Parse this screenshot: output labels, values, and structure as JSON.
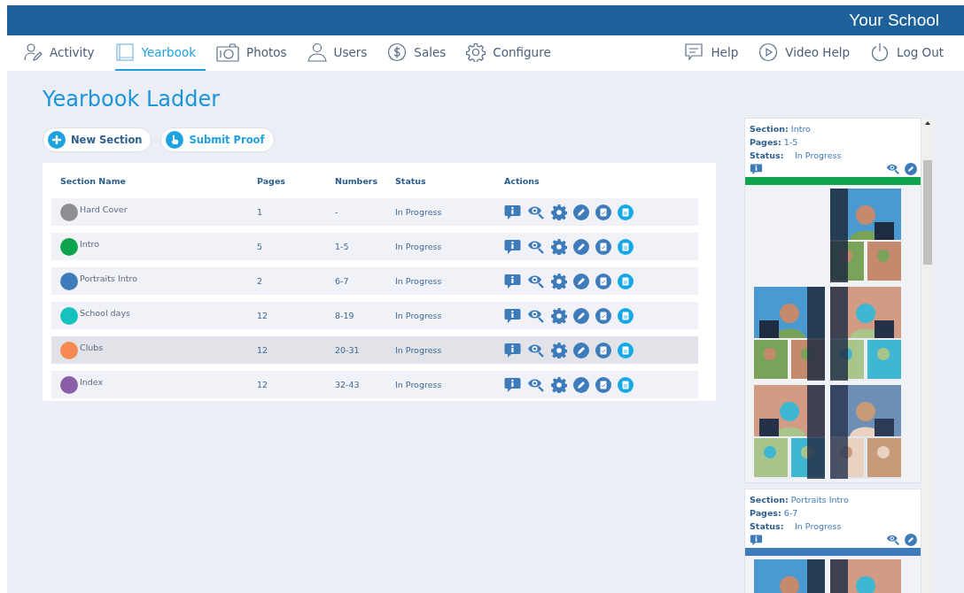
{
  "header": {
    "school": "Your School"
  },
  "nav": {
    "left": [
      {
        "label": "Activity",
        "selected": false
      },
      {
        "label": "Yearbook",
        "selected": true
      },
      {
        "label": "Photos",
        "selected": false
      },
      {
        "label": "Users",
        "selected": false
      },
      {
        "label": "Sales",
        "selected": false
      },
      {
        "label": "Configure",
        "selected": false
      }
    ],
    "right": [
      {
        "label": "Help"
      },
      {
        "label": "Video Help"
      },
      {
        "label": "Log Out"
      }
    ]
  },
  "title": "Yearbook Ladder",
  "buttons": [
    "New Section",
    "Submit Proof"
  ],
  "table": {
    "columns": [
      "Section Name",
      "Pages",
      "Numbers",
      "Status",
      "Actions"
    ],
    "rows": [
      {
        "name": "Hard Cover",
        "color": "#8e8f93",
        "pages": "1",
        "numbers": "-",
        "status": "In Progress",
        "selected": false
      },
      {
        "name": "Intro",
        "color": "#0ea44c",
        "pages": "5",
        "numbers": "1-5",
        "status": "In Progress",
        "selected": false
      },
      {
        "name": "Portraits Intro",
        "color": "#3d7bbb",
        "pages": "2",
        "numbers": "6-7",
        "status": "In Progress",
        "selected": false
      },
      {
        "name": "School days",
        "color": "#16c2be",
        "pages": "12",
        "numbers": "8-19",
        "status": "In Progress",
        "selected": false
      },
      {
        "name": "Clubs",
        "color": "#f68a52",
        "pages": "12",
        "numbers": "20-31",
        "status": "In Progress",
        "selected": true
      },
      {
        "name": "Index",
        "color": "#8a5fa8",
        "pages": "12",
        "numbers": "32-43",
        "status": "In Progress",
        "selected": false
      }
    ]
  },
  "previews": [
    {
      "section_label": "Section:",
      "section": "Intro",
      "pages_label": "Pages:",
      "pages": "1-5",
      "status_label": "Status:",
      "status": "In Progress",
      "color": "#0ea44c",
      "spreads": [
        [
          {
            "kind": "blank"
          },
          {
            "kind": "picture"
          }
        ],
        [
          {
            "kind": "picture"
          },
          {
            "kind": "picture"
          }
        ],
        [
          {
            "kind": "picture"
          },
          {
            "kind": "picture"
          }
        ]
      ]
    },
    {
      "section_label": "Section:",
      "section": "Portraits Intro",
      "pages_label": "Pages:",
      "pages": "6-7",
      "status_label": "Status:",
      "status": "In Progress",
      "color": "#3d7bbb",
      "spreads": [
        [
          {
            "kind": "picture"
          },
          {
            "kind": "picture"
          }
        ]
      ]
    }
  ]
}
